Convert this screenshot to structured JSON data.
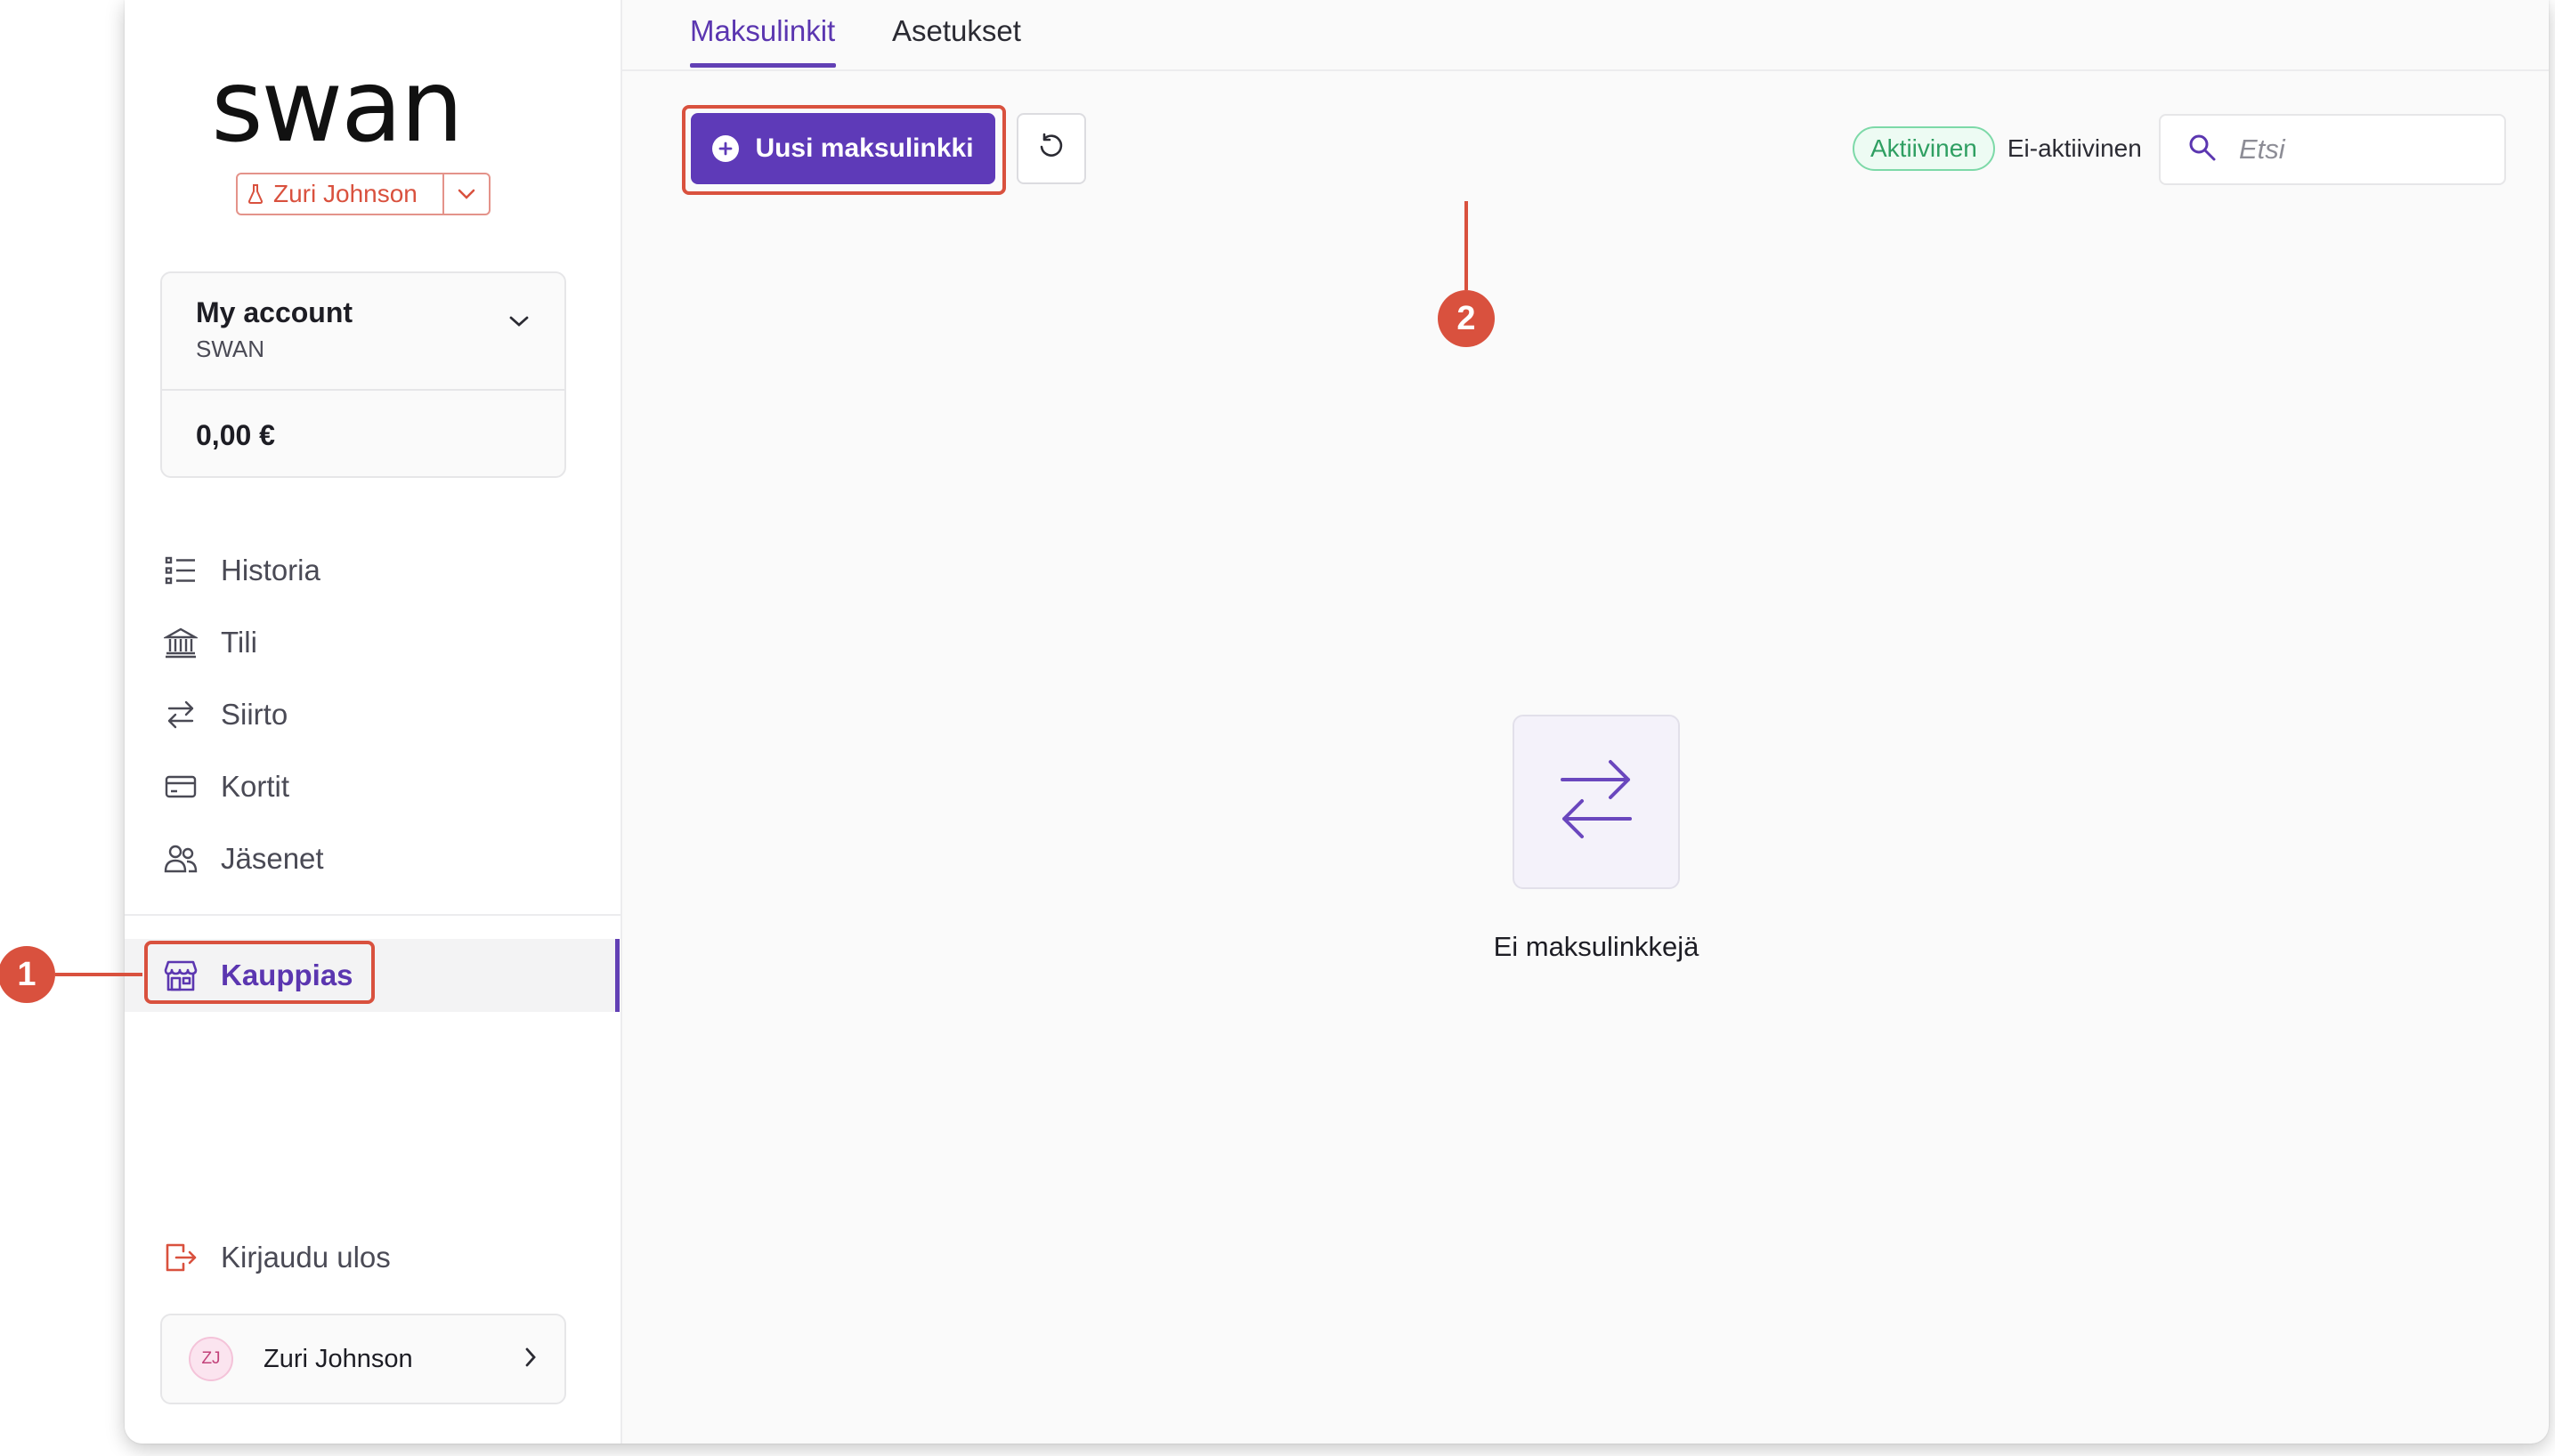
{
  "sidebar": {
    "brand": "swan",
    "user_switch": {
      "name": "Zuri Johnson"
    },
    "account": {
      "name": "My account",
      "subtitle": "SWAN",
      "balance": "0,00 €"
    },
    "nav": [
      {
        "label": "Historia",
        "icon": "list-icon"
      },
      {
        "label": "Tili",
        "icon": "bank-icon"
      },
      {
        "label": "Siirto",
        "icon": "transfer-icon"
      },
      {
        "label": "Kortit",
        "icon": "card-icon"
      },
      {
        "label": "Jäsenet",
        "icon": "members-icon"
      }
    ],
    "active_item": {
      "label": "Kauppias",
      "icon": "store-icon"
    },
    "logout": {
      "label": "Kirjaudu ulos",
      "icon": "logout-icon"
    },
    "user": {
      "initials": "ZJ",
      "name": "Zuri Johnson"
    }
  },
  "main": {
    "tabs": [
      {
        "label": "Maksulinkit",
        "active": true
      },
      {
        "label": "Asetukset",
        "active": false
      }
    ],
    "new_button": {
      "label": "Uusi maksulinkki"
    },
    "filter": {
      "active_label": "Aktiivinen",
      "inactive_label": "Ei-aktiivinen"
    },
    "search": {
      "placeholder": "Etsi"
    },
    "empty_state": {
      "text": "Ei maksulinkkejä"
    }
  },
  "annotations": [
    {
      "number": "1"
    },
    {
      "number": "2"
    }
  ],
  "colors": {
    "accent": "#5e3ab8",
    "annotation": "#d9513e",
    "active_filter": "#2f9f62",
    "user_switch": "#d9513e"
  }
}
